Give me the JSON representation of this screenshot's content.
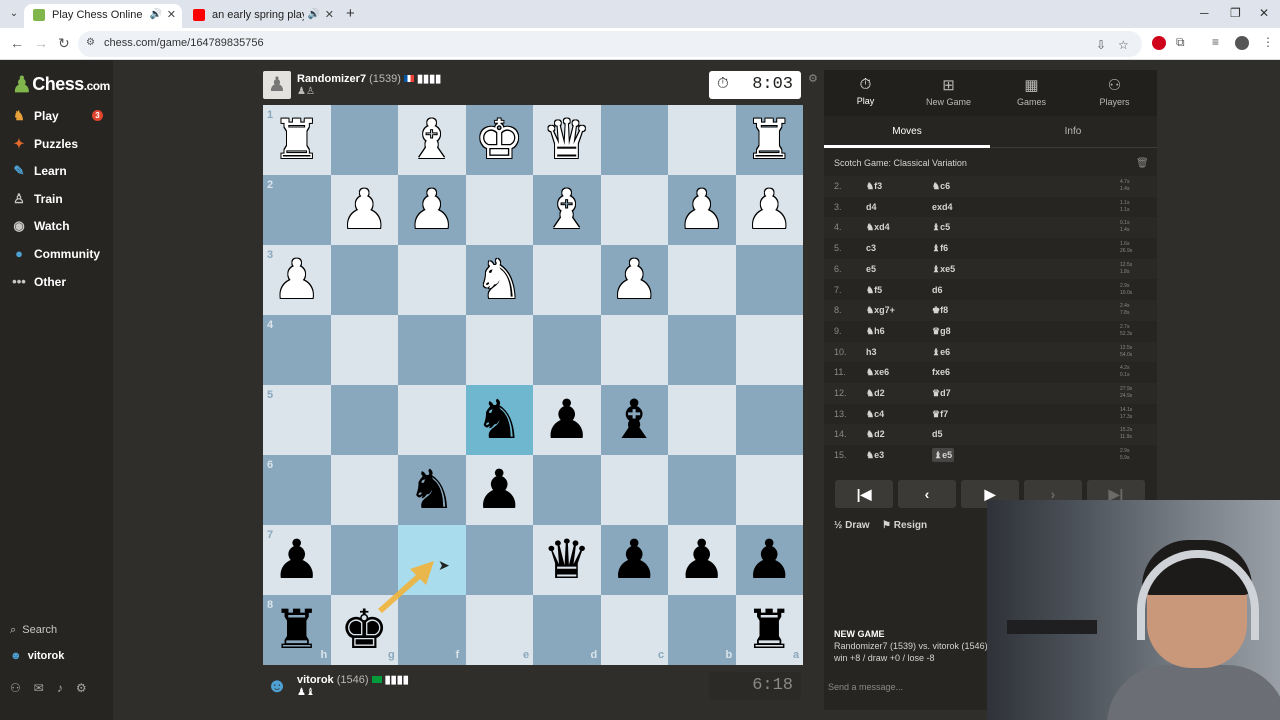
{
  "browser": {
    "tabs": [
      {
        "title": "Play Chess Online for FREE",
        "favicon_color": "#81b64c",
        "active": true
      },
      {
        "title": "an early spring playlist | soft",
        "favicon_color": "#ff0000",
        "active": false
      }
    ],
    "url": "chess.com/game/164789835756"
  },
  "sidebar": {
    "logo_main": "Chess",
    "logo_suffix": ".com",
    "items": [
      {
        "label": "Play",
        "icon": "play-icon"
      },
      {
        "label": "Puzzles",
        "icon": "puzzle-icon"
      },
      {
        "label": "Learn",
        "icon": "learn-icon"
      },
      {
        "label": "Train",
        "icon": "train-icon"
      },
      {
        "label": "Watch",
        "icon": "watch-icon"
      },
      {
        "label": "Community",
        "icon": "community-icon"
      },
      {
        "label": "Other",
        "icon": "more-icon"
      }
    ],
    "play_badge": "3",
    "search_label": "Search",
    "username": "vitorok"
  },
  "top_player": {
    "name": "Randomizer7",
    "rating": "(1539)",
    "clock": "8:03"
  },
  "bottom_player": {
    "name": "vitorok",
    "rating": "(1546)",
    "clock": "6:18"
  },
  "board": {
    "rank_labels": [
      "1",
      "2",
      "3",
      "4",
      "5",
      "6",
      "7",
      "8"
    ],
    "file_labels": [
      "h",
      "g",
      "f",
      "e",
      "d",
      "c",
      "b",
      "a"
    ],
    "pieces": [
      {
        "r": 0,
        "c": 0,
        "glyph": "♜",
        "color": "w"
      },
      {
        "r": 0,
        "c": 2,
        "glyph": "♝",
        "color": "w"
      },
      {
        "r": 0,
        "c": 3,
        "glyph": "♚",
        "color": "w"
      },
      {
        "r": 0,
        "c": 4,
        "glyph": "♛",
        "color": "w"
      },
      {
        "r": 0,
        "c": 7,
        "glyph": "♜",
        "color": "w"
      },
      {
        "r": 1,
        "c": 1,
        "glyph": "♟",
        "color": "w"
      },
      {
        "r": 1,
        "c": 2,
        "glyph": "♟",
        "color": "w"
      },
      {
        "r": 1,
        "c": 4,
        "glyph": "♝",
        "color": "w"
      },
      {
        "r": 1,
        "c": 6,
        "glyph": "♟",
        "color": "w"
      },
      {
        "r": 1,
        "c": 7,
        "glyph": "♟",
        "color": "w"
      },
      {
        "r": 2,
        "c": 0,
        "glyph": "♟",
        "color": "w"
      },
      {
        "r": 2,
        "c": 3,
        "glyph": "♞",
        "color": "w"
      },
      {
        "r": 2,
        "c": 5,
        "glyph": "♟",
        "color": "w"
      },
      {
        "r": 4,
        "c": 3,
        "glyph": "♞",
        "color": "b"
      },
      {
        "r": 4,
        "c": 4,
        "glyph": "♟",
        "color": "b"
      },
      {
        "r": 4,
        "c": 5,
        "glyph": "♝",
        "color": "b"
      },
      {
        "r": 5,
        "c": 2,
        "glyph": "♞",
        "color": "b"
      },
      {
        "r": 5,
        "c": 3,
        "glyph": "♟",
        "color": "b"
      },
      {
        "r": 6,
        "c": 0,
        "glyph": "♟",
        "color": "b"
      },
      {
        "r": 6,
        "c": 4,
        "glyph": "♛",
        "color": "b"
      },
      {
        "r": 6,
        "c": 5,
        "glyph": "♟",
        "color": "b"
      },
      {
        "r": 6,
        "c": 6,
        "glyph": "♟",
        "color": "b"
      },
      {
        "r": 6,
        "c": 7,
        "glyph": "♟",
        "color": "b"
      },
      {
        "r": 7,
        "c": 0,
        "glyph": "♜",
        "color": "b"
      },
      {
        "r": 7,
        "c": 1,
        "glyph": "♚",
        "color": "b"
      },
      {
        "r": 7,
        "c": 7,
        "glyph": "♜",
        "color": "b"
      }
    ],
    "highlights": [
      {
        "r": 4,
        "c": 3
      },
      {
        "r": 6,
        "c": 2
      }
    ],
    "colors": {
      "light": "#dbe4ea",
      "dark": "#89a8bd",
      "arrow": "#f0b23a"
    }
  },
  "panel": {
    "tabs": [
      {
        "label": "Play",
        "icon": "clock-icon",
        "active": true
      },
      {
        "label": "New Game",
        "icon": "plus-icon",
        "active": false
      },
      {
        "label": "Games",
        "icon": "board-icon",
        "active": false
      },
      {
        "label": "Players",
        "icon": "players-icon",
        "active": false
      }
    ],
    "subtabs": [
      "Moves",
      "Info"
    ],
    "opening": "Scotch Game: Classical Variation",
    "moves": [
      {
        "n": "2.",
        "w": "♞f3",
        "b": "♞c6",
        "tw": "4.7s",
        "tb": "1.4s"
      },
      {
        "n": "3.",
        "w": "d4",
        "b": "exd4",
        "tw": "1.1s",
        "tb": "1.1s"
      },
      {
        "n": "4.",
        "w": "♞xd4",
        "b": "♝c5",
        "tw": "0.1s",
        "tb": "1.4s"
      },
      {
        "n": "5.",
        "w": "c3",
        "b": "♝f6",
        "tw": "1.6s",
        "tb": "26.9s"
      },
      {
        "n": "6.",
        "w": "e5",
        "b": "♝xe5",
        "tw": "12.5s",
        "tb": "1.8s"
      },
      {
        "n": "7.",
        "w": "♞f5",
        "b": "d6",
        "tw": "2.9s",
        "tb": "10.0s"
      },
      {
        "n": "8.",
        "w": "♞xg7+",
        "b": "♚f8",
        "tw": "2.4s",
        "tb": "7.8s"
      },
      {
        "n": "9.",
        "w": "♞h6",
        "b": "♛g8",
        "tw": "2.7s",
        "tb": "52.3s"
      },
      {
        "n": "10.",
        "w": "h3",
        "b": "♝e6",
        "tw": "12.5s",
        "tb": "54.0s"
      },
      {
        "n": "11.",
        "w": "♞xe6",
        "b": "fxe6",
        "tw": "4.2s",
        "tb": "0.1s"
      },
      {
        "n": "12.",
        "w": "♞d2",
        "b": "♛d7",
        "tw": "27.9s",
        "tb": "24.9s"
      },
      {
        "n": "13.",
        "w": "♞c4",
        "b": "♛f7",
        "tw": "14.1s",
        "tb": "17.3s"
      },
      {
        "n": "14.",
        "w": "♞d2",
        "b": "d5",
        "tw": "15.2s",
        "tb": "11.9s"
      },
      {
        "n": "15.",
        "w": "♞e3",
        "b": "♝e5",
        "tw": "2.9s",
        "tb": "5.9s"
      }
    ],
    "draw_label": "Draw",
    "resign_label": "Resign",
    "new_game_header": "NEW GAME",
    "new_game_line": "Randomizer7 (1539) vs. vitorok (1546)",
    "new_game_odds": "win +8 / draw +0 / lose -8",
    "message_placeholder": "Send a message..."
  }
}
